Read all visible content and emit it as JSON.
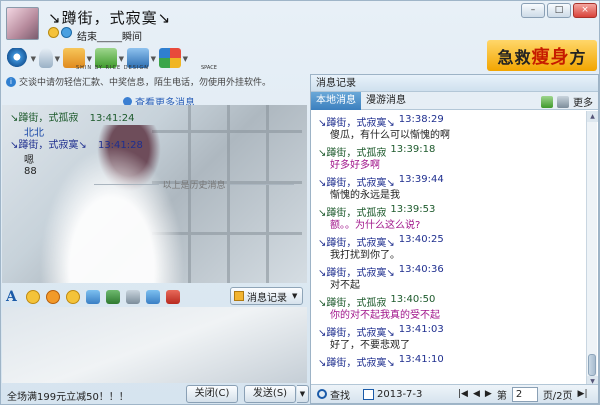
{
  "window": {
    "contact_name": "↘蹲街，式寂寞↘",
    "signature": "结束_____瞬间",
    "min_label": "–",
    "max_label": "□",
    "close_label": "×"
  },
  "ad": {
    "prefix": "急救",
    "highlight": "瘦身",
    "suffix": "方"
  },
  "watermark": {
    "left": "SHIN BY RICE DESIGN",
    "right": "SPACE"
  },
  "notice": "交谈中请勿轻信汇款、中奖信息，陌生电话，勿使用外挂软件。",
  "more_messages": "查看更多消息",
  "chat": {
    "messages": [
      {
        "name": "↘蹲街，式孤寂",
        "time": "13:41:24",
        "body": "北北"
      },
      {
        "name": "↘蹲街，式寂寞↘",
        "time": "13:41:28",
        "body": "嗯\n88"
      }
    ],
    "history_divider": "以上是历史消息"
  },
  "input": {
    "msg_record_label": "消息记录"
  },
  "bottom": {
    "promo": "全场满199元立减50！！！",
    "close_label": "关闭(C)",
    "send_label": "发送(S)",
    "send_arrow": "▼"
  },
  "panel": {
    "title": "消息记录",
    "tabs": [
      "本地消息",
      "漫游消息"
    ],
    "more_label": "更多",
    "records": [
      {
        "style": "b",
        "name": "↘蹲街，式寂寞↘",
        "time": "13:38:29",
        "text": "傻瓜，有什么可以惭愧的啊"
      },
      {
        "style": "g",
        "name": "↘蹲街，式孤寂",
        "time": "13:39:18",
        "text": "好多好多啊"
      },
      {
        "style": "b",
        "name": "↘蹲街，式寂寞↘",
        "time": "13:39:44",
        "text": "惭愧的永远是我"
      },
      {
        "style": "g",
        "name": "↘蹲街，式孤寂",
        "time": "13:39:53",
        "text": "额。。为什么这么说?"
      },
      {
        "style": "b",
        "name": "↘蹲街，式寂寞↘",
        "time": "13:40:25",
        "text": "我打扰到你了。"
      },
      {
        "style": "b",
        "name": "↘蹲街，式寂寞↘",
        "time": "13:40:36",
        "text": "对不起"
      },
      {
        "style": "g",
        "name": "↘蹲街，式孤寂",
        "time": "13:40:50",
        "text": "你的对不起我真的受不起"
      },
      {
        "style": "b",
        "name": "↘蹲街，式寂寞↘",
        "time": "13:41:03",
        "text": "好了，不要悲观了"
      },
      {
        "style": "b",
        "name": "↘蹲街，式寂寞↘",
        "time": "13:41:10",
        "text": ""
      }
    ],
    "find_label": "查找",
    "date": "2013-7-3",
    "page_prefix": "第",
    "page_current": "2",
    "page_suffix": "页/2页"
  }
}
